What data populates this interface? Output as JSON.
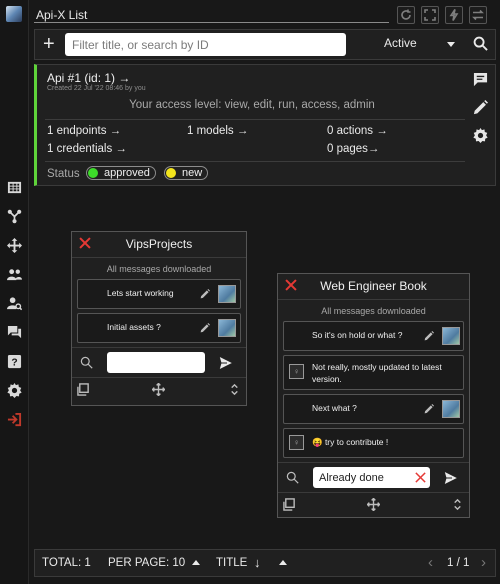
{
  "app": {
    "title": "Api-X List"
  },
  "header_buttons": [
    "refresh-icon",
    "fullscreen-icon",
    "flash-icon",
    "swap-icon"
  ],
  "filter": {
    "placeholder": "Filter title, or search by ID",
    "value": "",
    "status": "Active"
  },
  "api_card": {
    "title": "Api #1 (id: 1) →",
    "created": "Created 22 Jul '22 08:46 by you",
    "access": "Your access level: view, edit, run, access, admin",
    "endpoints": "1 endpoints →",
    "models": "1 models →",
    "actions": "0 actions →",
    "credentials": "1 credentials →",
    "pages": "0 pages→",
    "status_label": "Status",
    "badges": [
      {
        "label": "approved",
        "color": "#3ddc2a"
      },
      {
        "label": "new",
        "color": "#f2e41d"
      }
    ]
  },
  "chats": [
    {
      "title": "VipsProjects",
      "subtitle": "All messages downloaded",
      "messages": [
        {
          "text": "Lets start working"
        },
        {
          "text": "Initial assets ?"
        }
      ],
      "input_value": ""
    },
    {
      "title": "Web Engineer Book",
      "subtitle": "All messages downloaded",
      "messages": [
        {
          "text": "So it's on hold or what ?",
          "mine": true
        },
        {
          "text_line1": "Not really, mostly updated to latest",
          "text_line2": "version.",
          "mine": false
        },
        {
          "text": "Next what ?",
          "mine": true
        },
        {
          "text": "😝 try to contribute !",
          "mine": false
        }
      ],
      "input_value": "Already done"
    }
  ],
  "footer": {
    "total": "TOTAL:  1",
    "per_page": "PER PAGE:  10",
    "sort": "TITLE",
    "pagination": "1 / 1"
  },
  "colors": {
    "accent_green": "#5fd33a",
    "close_red": "#e53935"
  }
}
